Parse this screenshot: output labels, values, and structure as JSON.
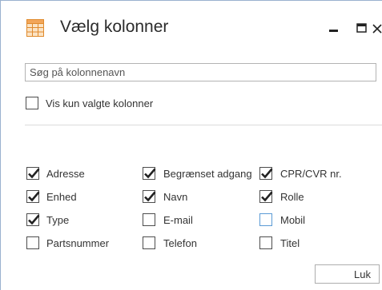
{
  "dialog": {
    "title": "Vælg kolonner",
    "search_placeholder": "Søg på kolonnenavn",
    "only_selected": {
      "label": "Vis kun valgte kolonner",
      "checked": false
    },
    "close_label": "Luk",
    "icons": {
      "app": "table-icon",
      "minimize": "minimize-icon",
      "maximize": "maximize-icon",
      "close": "close-icon"
    }
  },
  "columns": [
    {
      "label": "Adresse",
      "checked": true
    },
    {
      "label": "Begrænset adgang",
      "checked": true
    },
    {
      "label": "CPR/CVR nr.",
      "checked": true
    },
    {
      "label": "Enhed",
      "checked": true
    },
    {
      "label": "Navn",
      "checked": true
    },
    {
      "label": "Rolle",
      "checked": true
    },
    {
      "label": "Type",
      "checked": true
    },
    {
      "label": "E-mail",
      "checked": false
    },
    {
      "label": "Mobil",
      "checked": false
    },
    {
      "label": "Partsnummer",
      "checked": false
    },
    {
      "label": "Telefon",
      "checked": false
    },
    {
      "label": "Titel",
      "checked": false
    }
  ]
}
